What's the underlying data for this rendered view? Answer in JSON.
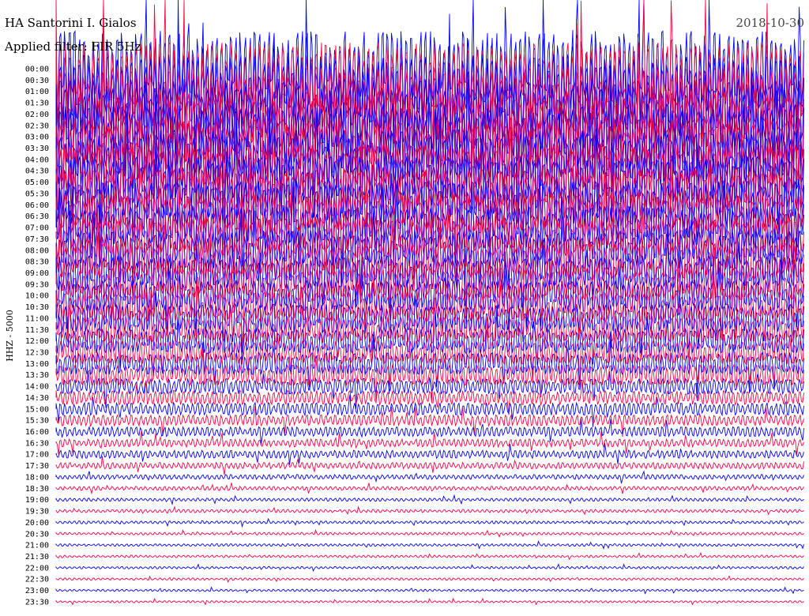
{
  "header": {
    "station": "HA Santorini I. Gialos",
    "date": "2018-10-30",
    "filter": "Applied filter: FIR 5Hz"
  },
  "chart_data": {
    "type": "line",
    "title": "HA Santorini I. Gialos",
    "subtitle": "Applied filter: FIR 5Hz",
    "ylabel": "HHZ - 5000",
    "colors": [
      "#0000ff",
      "#ff0040"
    ],
    "grid": false,
    "rows": [
      {
        "time": "00:00",
        "amplitude": 48
      },
      {
        "time": "00:30",
        "amplitude": 48
      },
      {
        "time": "01:00",
        "amplitude": 47
      },
      {
        "time": "01:30",
        "amplitude": 46
      },
      {
        "time": "02:00",
        "amplitude": 45
      },
      {
        "time": "02:30",
        "amplitude": 44
      },
      {
        "time": "03:00",
        "amplitude": 42
      },
      {
        "time": "03:30",
        "amplitude": 40
      },
      {
        "time": "04:00",
        "amplitude": 38
      },
      {
        "time": "04:30",
        "amplitude": 36
      },
      {
        "time": "05:00",
        "amplitude": 34
      },
      {
        "time": "05:30",
        "amplitude": 32
      },
      {
        "time": "06:00",
        "amplitude": 30
      },
      {
        "time": "06:30",
        "amplitude": 28
      },
      {
        "time": "07:00",
        "amplitude": 27
      },
      {
        "time": "07:30",
        "amplitude": 26
      },
      {
        "time": "08:00",
        "amplitude": 25
      },
      {
        "time": "08:30",
        "amplitude": 24
      },
      {
        "time": "09:00",
        "amplitude": 22
      },
      {
        "time": "09:30",
        "amplitude": 21
      },
      {
        "time": "10:00",
        "amplitude": 20
      },
      {
        "time": "10:30",
        "amplitude": 19
      },
      {
        "time": "11:00",
        "amplitude": 18
      },
      {
        "time": "11:30",
        "amplitude": 17
      },
      {
        "time": "12:00",
        "amplitude": 16
      },
      {
        "time": "12:30",
        "amplitude": 15
      },
      {
        "time": "13:00",
        "amplitude": 14
      },
      {
        "time": "13:30",
        "amplitude": 13
      },
      {
        "time": "14:00",
        "amplitude": 10
      },
      {
        "time": "14:30",
        "amplitude": 9
      },
      {
        "time": "15:00",
        "amplitude": 8
      },
      {
        "time": "15:30",
        "amplitude": 7
      },
      {
        "time": "16:00",
        "amplitude": 6
      },
      {
        "time": "16:30",
        "amplitude": 5
      },
      {
        "time": "17:00",
        "amplitude": 5
      },
      {
        "time": "17:30",
        "amplitude": 4
      },
      {
        "time": "18:00",
        "amplitude": 3
      },
      {
        "time": "18:30",
        "amplitude": 2.5
      },
      {
        "time": "19:00",
        "amplitude": 2
      },
      {
        "time": "19:30",
        "amplitude": 2
      },
      {
        "time": "20:00",
        "amplitude": 1.8
      },
      {
        "time": "20:30",
        "amplitude": 1.6
      },
      {
        "time": "21:00",
        "amplitude": 1.6
      },
      {
        "time": "21:30",
        "amplitude": 1.5
      },
      {
        "time": "22:00",
        "amplitude": 1.5
      },
      {
        "time": "22:30",
        "amplitude": 1.4
      },
      {
        "time": "23:00",
        "amplitude": 1.4
      },
      {
        "time": "23:30",
        "amplitude": 1.3
      }
    ]
  }
}
